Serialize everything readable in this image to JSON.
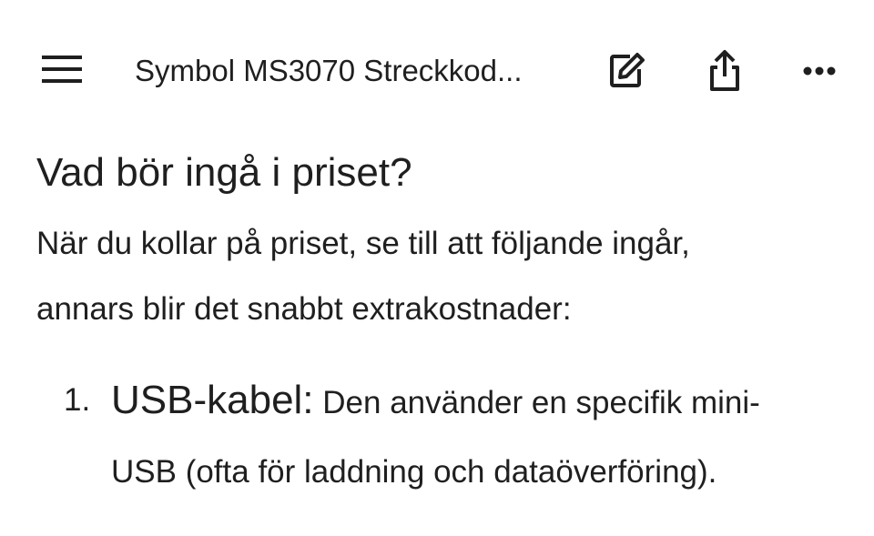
{
  "header": {
    "menu_icon": "hamburger-menu-icon",
    "title": "Symbol MS3070 Streckkod...",
    "edit_icon": "edit-icon",
    "share_icon": "share-icon",
    "more_icon": "more-horizontal-icon"
  },
  "content": {
    "heading": "Vad bör ingå i priset?",
    "paragraph_line1": "När du kollar på priset, se till att följande ingår,",
    "paragraph_line2": "annars blir det snabbt extrakostnader:",
    "list": [
      {
        "number": "1.",
        "title": "USB-kabel:",
        "text_line1": " Den använder en specifik mini-",
        "text_line2": "USB (ofta för laddning och dataöverföring)."
      }
    ]
  },
  "colors": {
    "text": "#1f1f1f",
    "background": "#ffffff"
  }
}
